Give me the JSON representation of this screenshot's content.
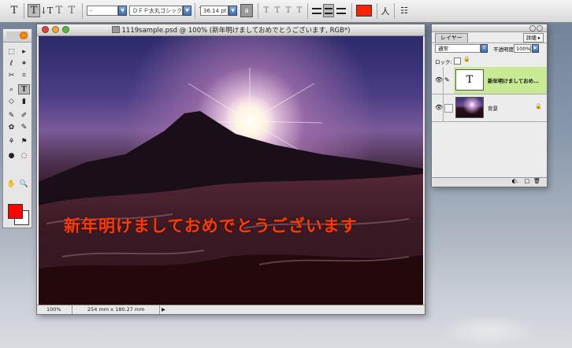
{
  "colors": {
    "foreground": "#ff0000",
    "background": "#ffffff",
    "text_swatch": "#ff2200",
    "layer_selected": "#c8ea94",
    "greeting": "#ff3a00"
  },
  "options_bar": {
    "tool_icon": "T",
    "orient_h": "T",
    "orient_v": "↓T",
    "mask_h": "T",
    "mask_v": "T",
    "font_family": "-",
    "font_style": "ＤＦＰ太丸ゴシック体",
    "font_size": "36.14 pt",
    "aa": "a",
    "styles": [
      "T",
      "T",
      "T",
      "T"
    ],
    "warp": "人",
    "palette": "☷"
  },
  "document": {
    "title": "1119sample.psd @ 100% (新年明けましておめでとうございます, RGB*)",
    "greeting": "新年明けましておめでとうございます",
    "zoom": "100%",
    "size": "254 mm x 180.27 mm",
    "arrow": "▶"
  },
  "layers_panel": {
    "tab": "レイヤー",
    "detail_button": "詳細 ▸",
    "blend_mode": "通常",
    "opacity_label": "不透明度:",
    "opacity": "100%",
    "lock_label": "ロック:",
    "lock_icon": "🔒",
    "text_layer_thumb": "T",
    "text_layer_name": "新年明けましておめ…",
    "bg_layer_name": "背景",
    "eye": "👁",
    "footer_icons": [
      "◐.",
      "□",
      "🗑"
    ]
  },
  "toolbox": {
    "tools": [
      "⬚",
      "▸",
      "ℓ",
      "✶",
      "✂",
      "⌗",
      "⌕",
      "T",
      "◇",
      "▮",
      "✎",
      "✐",
      "✿",
      "✎",
      "⚘",
      "⚑",
      "●",
      "◌",
      "✋",
      "🔍"
    ]
  }
}
